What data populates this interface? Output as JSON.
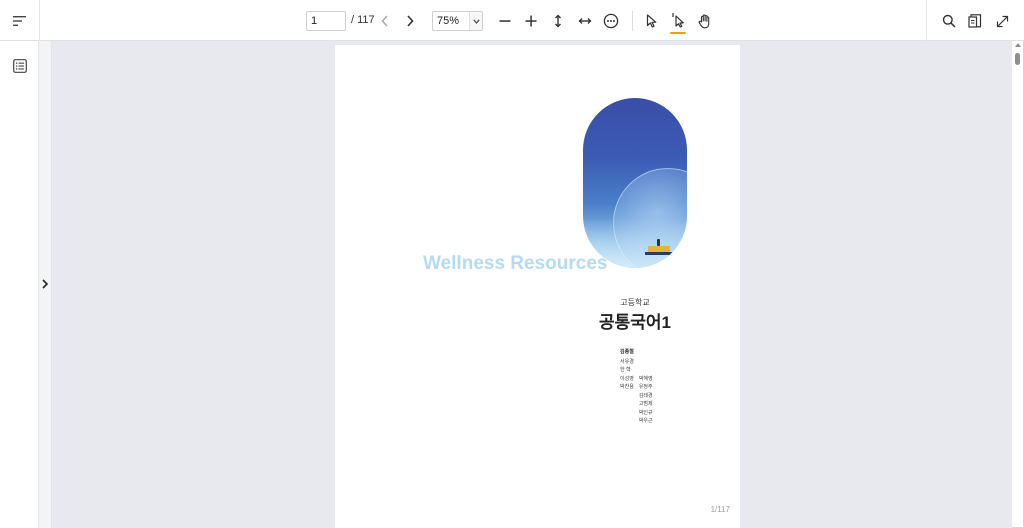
{
  "toolbar": {
    "page_input_value": "1",
    "page_total": "/ 117",
    "zoom_value": "75%",
    "icons": {
      "menu": "sort-menu-icon",
      "prev": "chevron-left-icon",
      "next": "chevron-right-icon",
      "zoom_out": "minus-icon",
      "zoom_in": "plus-icon",
      "fit_height": "fit-height-icon",
      "fit_width": "fit-width-icon",
      "more": "more-icon",
      "select": "cursor-icon",
      "text_select": "text-cursor-icon",
      "hand": "hand-icon",
      "search": "search-icon",
      "document": "document-icon",
      "fullscreen": "fullscreen-icon"
    },
    "active_tool_color": "#f5a000"
  },
  "sidebar": {
    "toc_icon": "list-icon",
    "toggle_icon": "chevron-right-icon"
  },
  "document": {
    "watermark": "Wellness Resources",
    "school": "고등학교",
    "title": "공통국어1",
    "lead_author": "김종철",
    "authors_col1": [
      "서유경",
      "한  혁",
      "이성영",
      "박찬용"
    ],
    "authors_col2": [
      "",
      "",
      "박혜영",
      "유정주",
      "김태경",
      "고범제",
      "박인규",
      "박우근"
    ],
    "page_label": "1/117"
  },
  "colors": {
    "viewer_bg": "#e8e9ee",
    "cover_blue": "#3a4ea7"
  }
}
